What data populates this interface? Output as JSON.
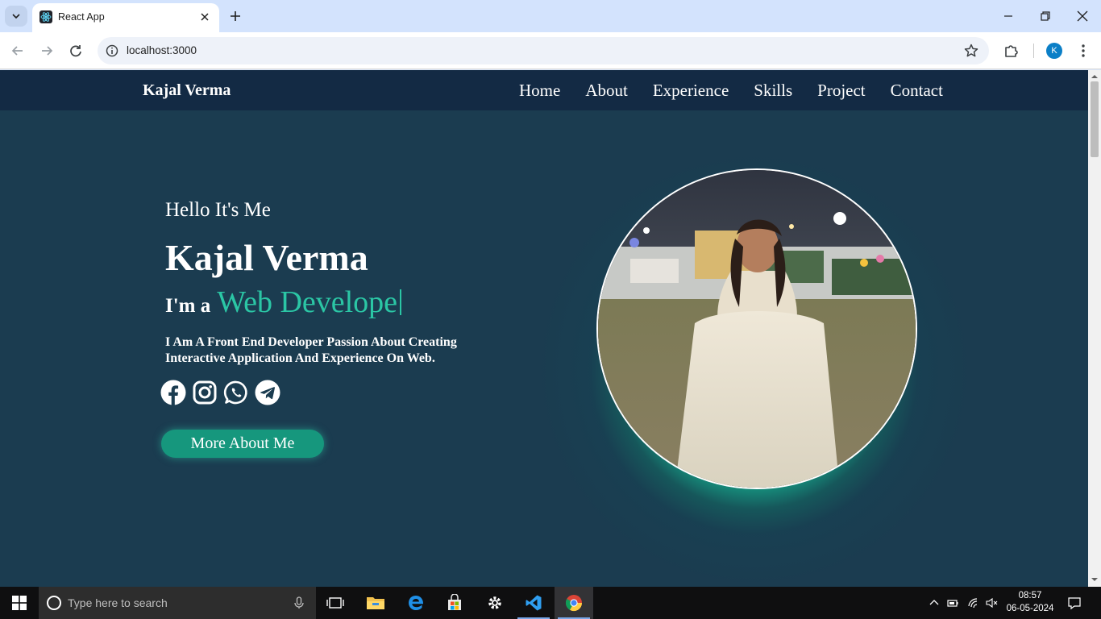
{
  "browser": {
    "tab_title": "React App",
    "url": "localhost:3000",
    "profile_initial": "K"
  },
  "site": {
    "brand": "Kajal Verma",
    "nav": [
      "Home",
      "About",
      "Experience",
      "Skills",
      "Project",
      "Contact"
    ],
    "greeting": "Hello It's Me",
    "name": "Kajal Verma",
    "role_prefix": "I'm a",
    "role_typed": "Web Develope",
    "intro": "I Am A Front End Developer Passion About Creating Interactive Application And Experience On Web.",
    "socials": [
      "facebook-icon",
      "instagram-icon",
      "whatsapp-icon",
      "telegram-icon"
    ],
    "cta": "More About Me",
    "accent_color": "#2bc6a5",
    "background_color": "#1b3c50",
    "nav_color": "#132a44"
  },
  "taskbar": {
    "search_placeholder": "Type here to search",
    "time": "08:57",
    "date": "06-05-2024"
  }
}
